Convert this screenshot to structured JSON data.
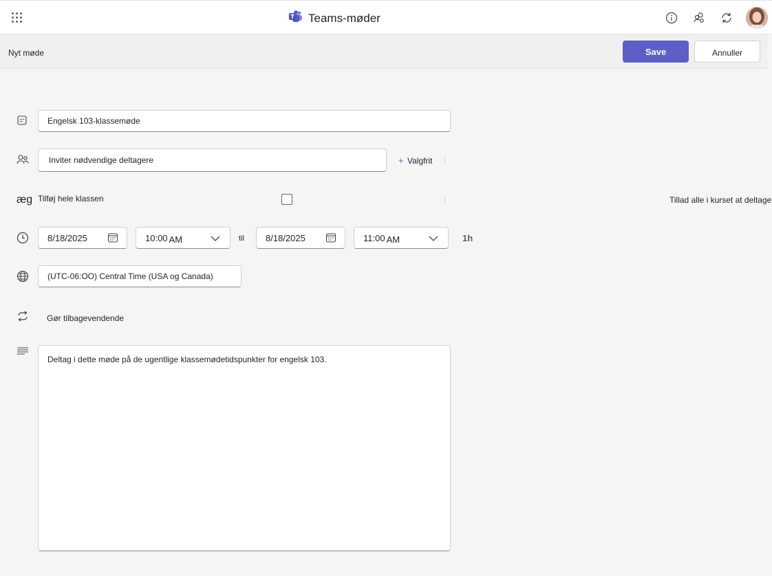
{
  "app": {
    "title": "Teams-møder"
  },
  "command_bar": {
    "title": "Nyt møde",
    "save_label": "Save",
    "cancel_label": "Annuller"
  },
  "form": {
    "title_value": "Engelsk 103-klassemøde",
    "attendees_placeholder": "Inviter nødvendige deltagere",
    "optional_label": "Valgfrit",
    "row_prefix": "æg",
    "add_class_label": "Tilføj hele klassen",
    "allow_all_label": "Tillad alle i kurset at deltage",
    "start_date": "8/18/2025",
    "start_time": "10:00",
    "start_ampm": "AM",
    "to_label": "til",
    "end_date": "8/18/2025",
    "end_time": "11:00",
    "end_ampm": "AM",
    "duration": "1h",
    "timezone": "(UTC-06:OO) Central Time (USA og Canada)",
    "recurrence_label": "Gør tilbagevendende",
    "description": "Deltag i dette møde på de ugentlige klassemødetidspunkter for engelsk 103.",
    "add_class_checked": false
  },
  "icons": [
    "waffle-icon",
    "teams-logo-icon",
    "info-icon",
    "people-settings-icon",
    "refresh-icon",
    "title-icon",
    "people-icon",
    "clock-icon",
    "calendar-icon",
    "chevron-down-icon",
    "globe-icon",
    "repeat-icon",
    "text-lines-icon"
  ],
  "colors": {
    "accent": "#5b5fc7",
    "background": "#f5f5f5"
  }
}
